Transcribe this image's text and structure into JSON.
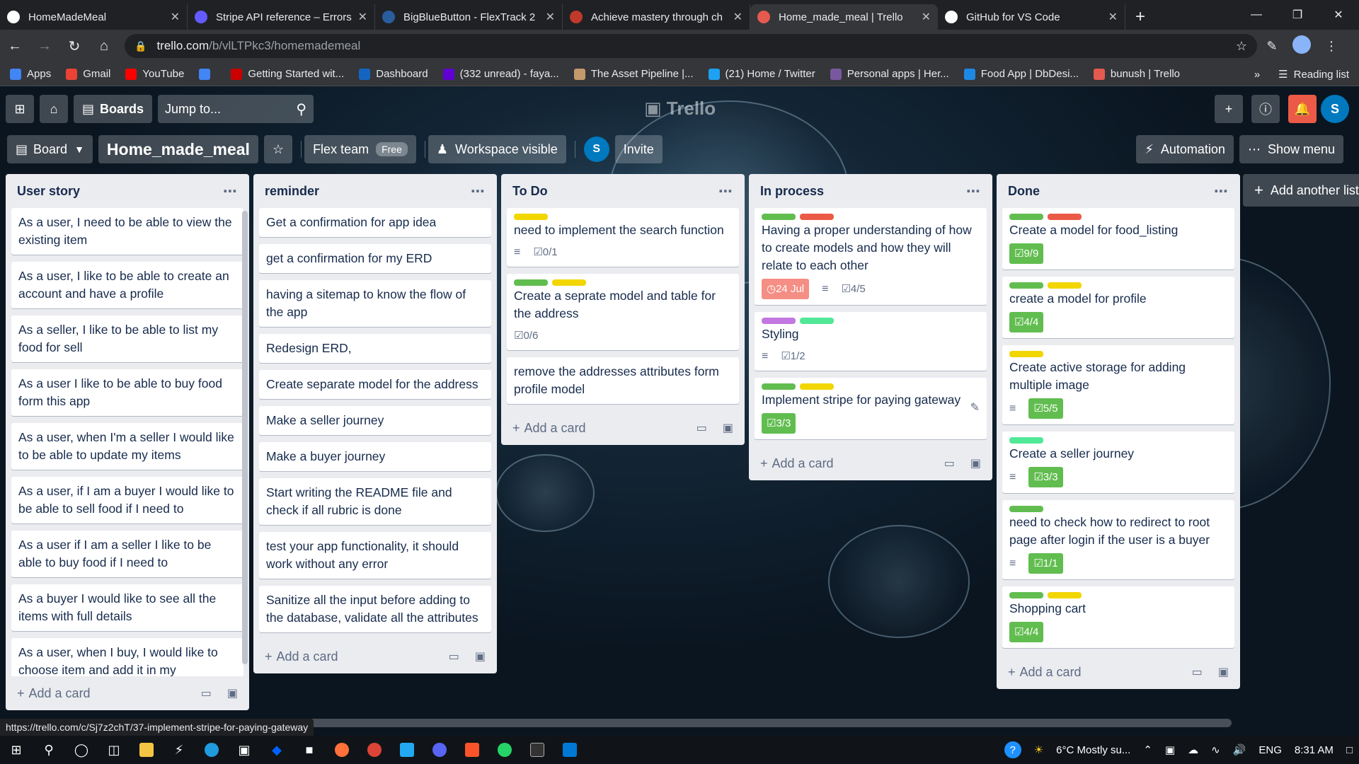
{
  "browser": {
    "tabs": [
      {
        "title": "HomeMadeMeal",
        "color": "#ffffff"
      },
      {
        "title": "Stripe API reference – Errors",
        "color": "#635bff"
      },
      {
        "title": "BigBlueButton - FlexTrack 2",
        "color": "#2a5d9e"
      },
      {
        "title": "Achieve mastery through ch",
        "color": "#c0392b"
      },
      {
        "title": "Home_made_meal | Trello",
        "color": "#e55a4f"
      },
      {
        "title": "GitHub for VS Code",
        "color": "#ffffff"
      }
    ],
    "active_tab": 4,
    "url_host": "trello.com",
    "url_path": "/b/vlLTPkc3/homemademeal",
    "bookmarks": [
      {
        "label": "Apps",
        "color": "#4285f4"
      },
      {
        "label": "Gmail",
        "color": "#ea4335"
      },
      {
        "label": "YouTube",
        "color": "#ff0000"
      },
      {
        "label": "",
        "color": "#4285f4"
      },
      {
        "label": "Getting Started wit...",
        "color": "#cc0000"
      },
      {
        "label": "Dashboard",
        "color": "#1565c0"
      },
      {
        "label": "(332 unread) - faya...",
        "color": "#6001d2"
      },
      {
        "label": "The Asset Pipeline |...",
        "color": "#c49a6c"
      },
      {
        "label": "(21) Home / Twitter",
        "color": "#1da1f2"
      },
      {
        "label": "Personal apps | Her...",
        "color": "#79589f"
      },
      {
        "label": "Food App | DbDesi...",
        "color": "#1e88e5"
      },
      {
        "label": "bunush | Trello",
        "color": "#e55a4f"
      }
    ],
    "reading_list": "Reading list",
    "more": "»"
  },
  "trello": {
    "boards_label": "Boards",
    "jump_placeholder": "Jump to...",
    "logo": "Trello",
    "avatar_initial": "S"
  },
  "board": {
    "view_label": "Board",
    "title": "Home_made_meal",
    "team": "Flex team",
    "team_badge": "Free",
    "visibility": "Workspace visible",
    "member_initial": "S",
    "invite": "Invite",
    "automation": "Automation",
    "show_menu": "Show menu"
  },
  "lists": [
    {
      "title": "User story",
      "cards": [
        {
          "text": "As a user, I need to be able to view the existing item"
        },
        {
          "text": "As a user, I like to be able to create an account and have a profile"
        },
        {
          "text": "As a seller, I like to be able to list my food for sell"
        },
        {
          "text": "As a user I like to be able to buy food form this app"
        },
        {
          "text": "As a user, when I'm a seller I would like to be able to update my items"
        },
        {
          "text": "As a user, if I am a buyer I would like to be able to sell food if I need to"
        },
        {
          "text": "As a user if I am a seller I like to be able to buy food if I need to"
        },
        {
          "text": "As a buyer I would like to see all the items with full details"
        },
        {
          "text": "As a user, when I buy, I would like to choose item and add it in my"
        }
      ]
    },
    {
      "title": "reminder",
      "cards": [
        {
          "text": "Get a confirmation for app idea"
        },
        {
          "text": "get a confirmation for my ERD"
        },
        {
          "text": "having a sitemap to know the flow of the app"
        },
        {
          "text": "Redesign ERD,"
        },
        {
          "text": "Create separate model for the address"
        },
        {
          "text": "Make a seller journey"
        },
        {
          "text": "Make a buyer journey"
        },
        {
          "text": "Start writing the README file and check if all rubric is done"
        },
        {
          "text": "test your app functionality, it should work without any error"
        },
        {
          "text": "Sanitize all the input before adding to the database, validate all the attributes"
        }
      ]
    },
    {
      "title": "To Do",
      "cards": [
        {
          "text": "need to implement the search function",
          "labels": [
            "#f2d600"
          ],
          "desc": true,
          "checklist": "0/1"
        },
        {
          "text": "Create a seprate model and table for the address",
          "labels": [
            "#61bd4f",
            "#f2d600"
          ],
          "checklist": "0/6"
        },
        {
          "text": "remove the addresses attributes form profile model"
        }
      ]
    },
    {
      "title": "In process",
      "cards": [
        {
          "text": "Having a proper understanding of how to create models and how they will relate to each other",
          "labels": [
            "#61bd4f",
            "#eb5a46"
          ],
          "due": "24 Jul",
          "desc": true,
          "checklist": "4/5"
        },
        {
          "text": "Styling",
          "labels": [
            "#c377e0",
            "#51e898"
          ],
          "desc": true,
          "checklist": "1/2"
        },
        {
          "text": "Implement stripe for paying gateway",
          "labels": [
            "#61bd4f",
            "#f2d600"
          ],
          "checklist_done": "3/3",
          "editing": true
        }
      ]
    },
    {
      "title": "Done",
      "cards": [
        {
          "text": "Create a model for food_listing",
          "labels": [
            "#61bd4f",
            "#eb5a46"
          ],
          "checklist_done": "9/9"
        },
        {
          "text": "create a model for profile",
          "labels": [
            "#61bd4f",
            "#f2d600"
          ],
          "checklist_done": "4/4"
        },
        {
          "text": "Create active storage for adding multiple image",
          "labels": [
            "#f2d600"
          ],
          "desc": true,
          "checklist_done": "5/5"
        },
        {
          "text": "Create a seller journey",
          "labels": [
            "#51e898"
          ],
          "desc": true,
          "checklist_done": "3/3"
        },
        {
          "text": "need to check how to redirect to root page after login if the user is a buyer",
          "labels": [
            "#61bd4f"
          ],
          "desc": true,
          "checklist_done": "1/1"
        },
        {
          "text": "Shopping cart",
          "labels": [
            "#61bd4f",
            "#f2d600"
          ],
          "checklist_done": "4/4"
        }
      ]
    }
  ],
  "add_card_label": "Add a card",
  "add_list_label": "Add another list",
  "status_url": "https://trello.com/c/Sj7z2chT/37-implement-stripe-for-paying-gateway",
  "taskbar": {
    "weather": "6°C  Mostly su...",
    "language": "ENG",
    "time": "8:31 AM"
  }
}
